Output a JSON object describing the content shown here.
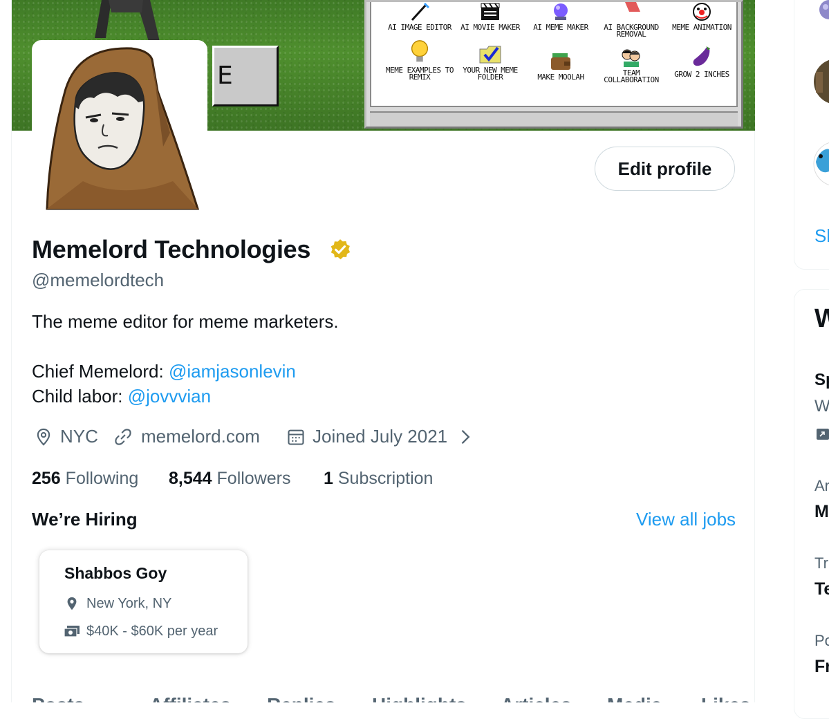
{
  "banner": {
    "retro_button_letter": "E",
    "apps": [
      {
        "label": "AI IMAGE EDITOR",
        "icon": "magic-wand-icon"
      },
      {
        "label": "AI MOVIE MAKER",
        "icon": "clapperboard-icon"
      },
      {
        "label": "AI MEME MAKER",
        "icon": "crystal-ball-icon"
      },
      {
        "label": "AI BACKGROUND REMOVAL",
        "icon": "eraser-icon"
      },
      {
        "label": "MEME ANIMATION",
        "icon": "clown-icon"
      },
      {
        "label": "MEME EXAMPLES TO REMIX",
        "icon": "lightbulb-icon"
      },
      {
        "label": "YOUR NEW MEME FOLDER",
        "icon": "folder-check-icon"
      },
      {
        "label": "MAKE MOOLAH",
        "icon": "wallet-icon"
      },
      {
        "label": "TEAM COLLABORATION",
        "icon": "people-icon"
      },
      {
        "label": "GROW 2 INCHES",
        "icon": "eggplant-icon"
      }
    ]
  },
  "profile": {
    "edit_profile_label": "Edit profile",
    "name": "Memelord Technologies",
    "handle": "@memelordtech",
    "bio_line1": "The meme editor for meme marketers.",
    "bio_chief_label": "Chief Memelord: ",
    "bio_chief_link": "@iamjasonlevin",
    "bio_child_label": "Child labor: ",
    "bio_child_link": "@jovvvian",
    "location": "NYC",
    "website": "memelord.com",
    "joined": "Joined July 2021",
    "following_count": "256",
    "following_label": "Following",
    "followers_count": "8,544",
    "followers_label": "Followers",
    "subscription_count": "1",
    "subscription_label": "Subscription"
  },
  "hiring": {
    "heading": "We’re Hiring",
    "view_all": "View all jobs",
    "job": {
      "title": "Shabbos Goy",
      "location": "New York, NY",
      "salary": "$40K - $60K per year"
    }
  },
  "tabs": [
    "Posts",
    "Affiliates",
    "Replies",
    "Highlights",
    "Articles",
    "Media",
    "Likes"
  ],
  "right_column": {
    "show_more_partial": "Sh",
    "card2_heading_partial": "W",
    "items": [
      {
        "a": "Sp",
        "b": "W"
      },
      {
        "a": "Ar",
        "b": "M"
      },
      {
        "a": "Tr",
        "b": "Te"
      },
      {
        "a": "Po",
        "b": "Fr"
      }
    ]
  },
  "colors": {
    "accent": "#1d9bf0",
    "secondary_text": "#536471",
    "verified_gold": "#e2b719"
  }
}
